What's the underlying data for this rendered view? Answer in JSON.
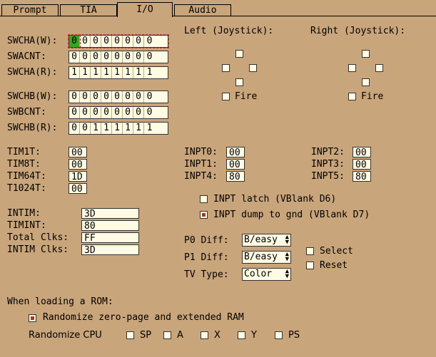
{
  "tabs": [
    "Prompt",
    "TIA",
    "I/O",
    "Audio"
  ],
  "active_tab": "I/O",
  "swch": {
    "swcha_w": {
      "label": "SWCHA(W):",
      "bits": [
        "0",
        "0",
        "0",
        "0",
        "0",
        "0",
        "0",
        "0"
      ]
    },
    "swacnt": {
      "label": "SWACNT:",
      "bits": [
        "0",
        "0",
        "0",
        "0",
        "0",
        "0",
        "0",
        "0"
      ]
    },
    "swcha_r": {
      "label": "SWCHA(R):",
      "bits": [
        "1",
        "1",
        "1",
        "1",
        "1",
        "1",
        "1",
        "1"
      ]
    },
    "swchb_w": {
      "label": "SWCHB(W):",
      "bits": [
        "0",
        "0",
        "0",
        "0",
        "0",
        "0",
        "0",
        "0"
      ]
    },
    "swbcnt": {
      "label": "SWBCNT:",
      "bits": [
        "0",
        "0",
        "0",
        "0",
        "0",
        "0",
        "0",
        "0"
      ]
    },
    "swchb_r": {
      "label": "SWCHB(R):",
      "bits": [
        "0",
        "0",
        "1",
        "1",
        "1",
        "1",
        "1",
        "1"
      ]
    }
  },
  "joysticks": {
    "left": {
      "title": "Left (Joystick):",
      "fire": "Fire"
    },
    "right": {
      "title": "Right (Joystick):",
      "fire": "Fire"
    }
  },
  "timers": [
    {
      "label": "TIM1T:",
      "value": "00"
    },
    {
      "label": "TIM8T:",
      "value": "00"
    },
    {
      "label": "TIM64T:",
      "value": "1D"
    },
    {
      "label": "T1024T:",
      "value": "00"
    }
  ],
  "intim": [
    {
      "label": "INTIM:",
      "value": "3D"
    },
    {
      "label": "TIMINT:",
      "value": "80"
    },
    {
      "label": "Total Clks:",
      "value": "FF"
    },
    {
      "label": "INTIM Clks:",
      "value": "3D"
    }
  ],
  "inpt_left": [
    {
      "label": "INPT0:",
      "value": "00"
    },
    {
      "label": "INPT1:",
      "value": "00"
    },
    {
      "label": "INPT4:",
      "value": "80"
    }
  ],
  "inpt_right": [
    {
      "label": "INPT2:",
      "value": "00"
    },
    {
      "label": "INPT3:",
      "value": "00"
    },
    {
      "label": "INPT5:",
      "value": "80"
    }
  ],
  "inpt_latch": {
    "label": "INPT latch (VBlank D6)",
    "checked": false
  },
  "inpt_dump": {
    "label": "INPT dump to gnd (VBlank D7)",
    "checked": true
  },
  "switches": {
    "p0_diff": {
      "label": "P0 Diff:",
      "value": "B/easy"
    },
    "p1_diff": {
      "label": "P1 Diff:",
      "value": "B/easy"
    },
    "tv_type": {
      "label": "TV Type:",
      "value": "Color"
    },
    "select": "Select",
    "reset": "Reset"
  },
  "rom": {
    "heading": "When loading a ROM:",
    "randomize_ram": {
      "label": "Randomize zero-page and extended RAM",
      "checked": true
    },
    "randomize_cpu_label": "Randomize CPU",
    "cpu_regs": [
      "SP",
      "A",
      "X",
      "Y",
      "PS"
    ]
  },
  "colors": {
    "background": "#c9a57b",
    "field": "#fffbe4",
    "selected_bit": "#3ea21b",
    "check_mark": "#b0341e"
  }
}
